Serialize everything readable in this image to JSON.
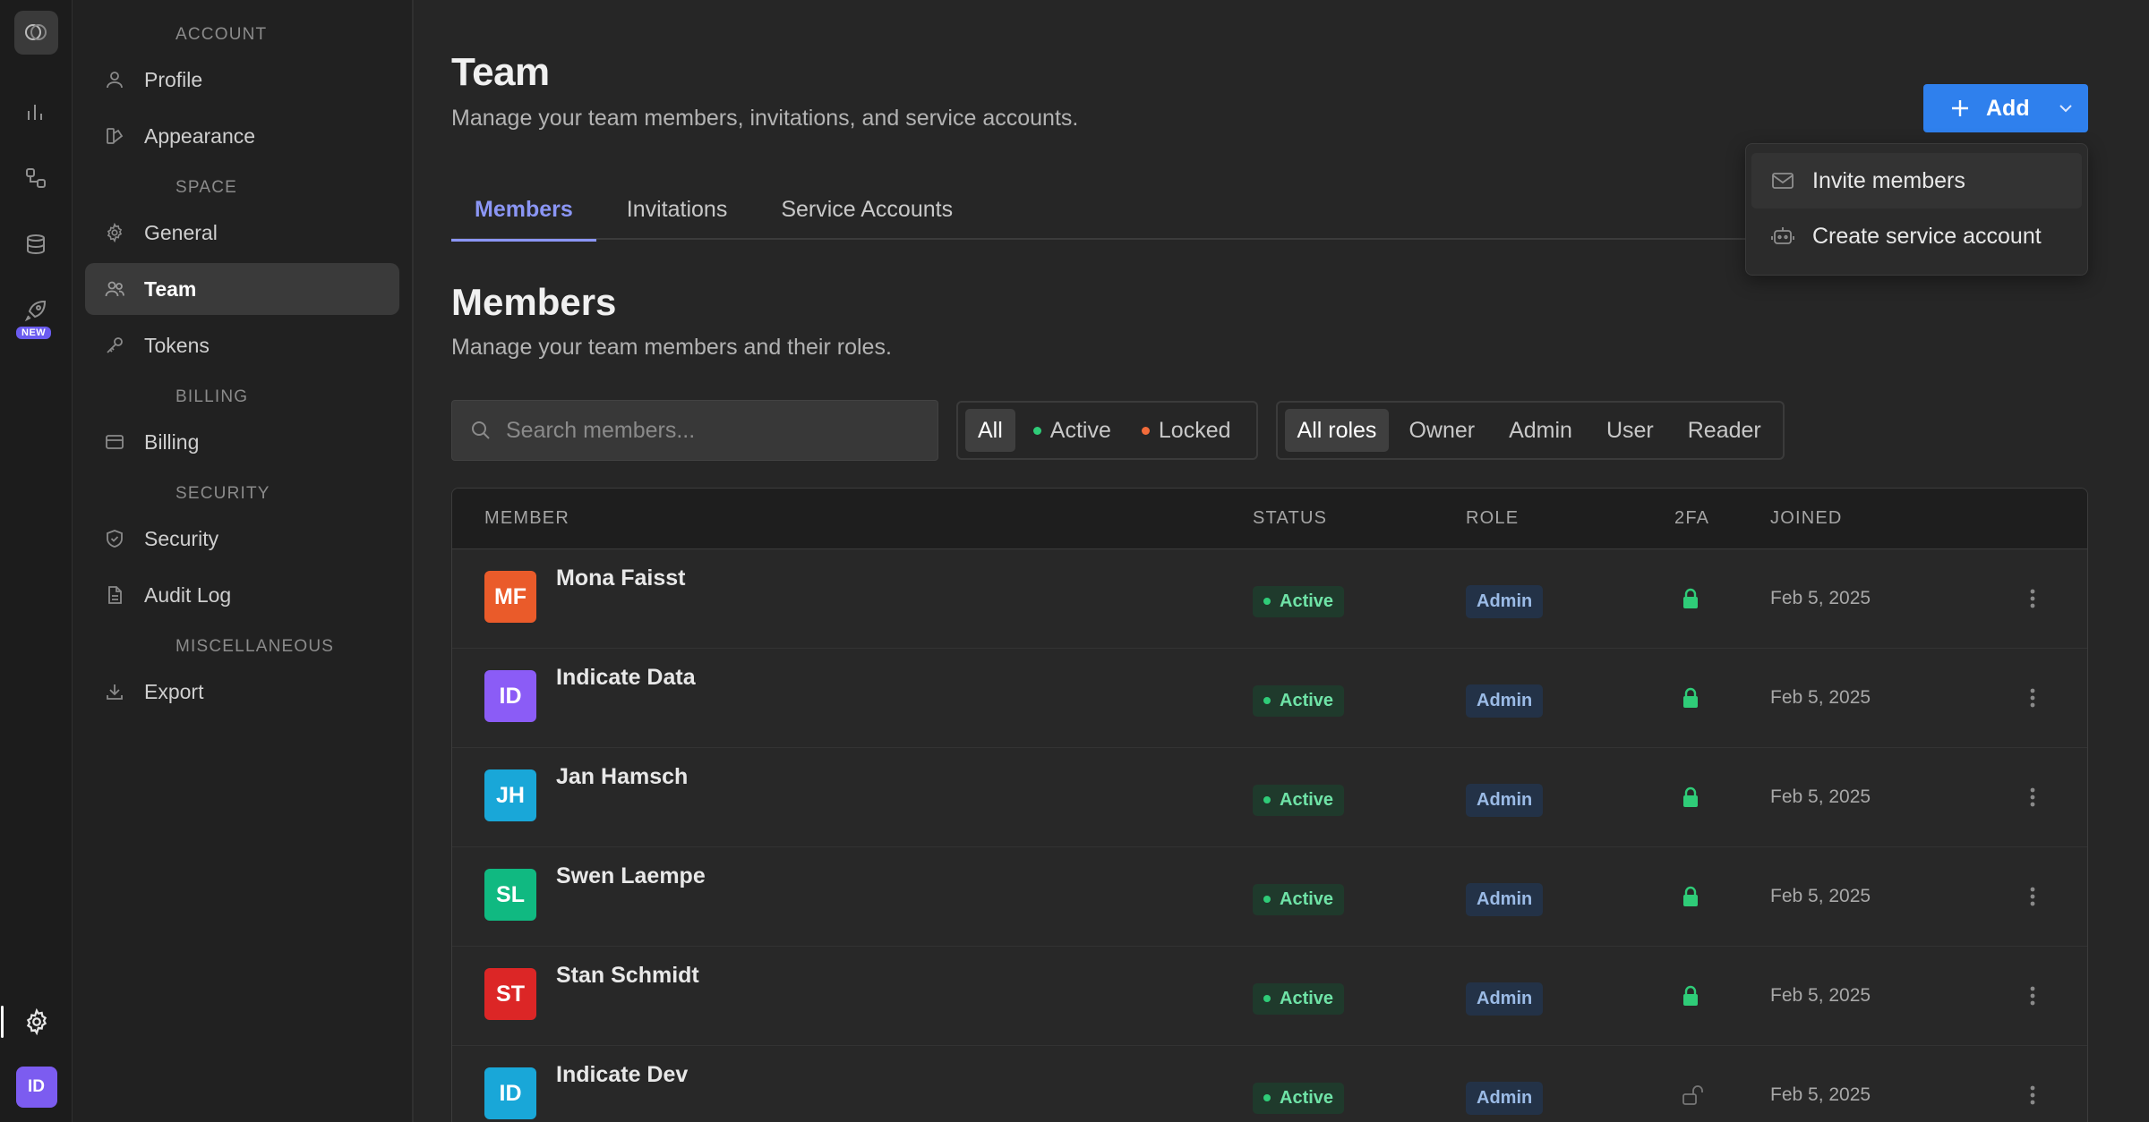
{
  "sidebar": {
    "groups": [
      {
        "title": "ACCOUNT",
        "items": [
          {
            "label": "Profile"
          },
          {
            "label": "Appearance"
          }
        ]
      },
      {
        "title": "SPACE",
        "items": [
          {
            "label": "General"
          },
          {
            "label": "Team"
          },
          {
            "label": "Tokens"
          }
        ]
      },
      {
        "title": "BILLING",
        "items": [
          {
            "label": "Billing"
          }
        ]
      },
      {
        "title": "SECURITY",
        "items": [
          {
            "label": "Security"
          },
          {
            "label": "Audit Log"
          }
        ]
      },
      {
        "title": "MISCELLANEOUS",
        "items": [
          {
            "label": "Export"
          }
        ]
      }
    ],
    "active_item": "Team"
  },
  "rail": {
    "new_badge": "NEW",
    "user_initials": "ID",
    "icons": [
      "app-logo-icon",
      "bar-chart-icon",
      "workflow-icon",
      "database-icon",
      "rocket-icon",
      "gear-icon"
    ]
  },
  "header": {
    "title": "Team",
    "subtitle": "Manage your team members, invitations, and service accounts.",
    "add_label": "Add"
  },
  "add_menu": {
    "items": [
      {
        "label": "Invite members"
      },
      {
        "label": "Create service account"
      }
    ]
  },
  "tabs": [
    {
      "label": "Members"
    },
    {
      "label": "Invitations"
    },
    {
      "label": "Service Accounts"
    }
  ],
  "members_section": {
    "title": "Members",
    "subtitle": "Manage your team members and their roles.",
    "search_placeholder": "Search members...",
    "status_filters": [
      {
        "label": "All"
      },
      {
        "label": "Active"
      },
      {
        "label": "Locked"
      }
    ],
    "role_filters": [
      {
        "label": "All roles"
      },
      {
        "label": "Owner"
      },
      {
        "label": "Admin"
      },
      {
        "label": "User"
      },
      {
        "label": "Reader"
      }
    ]
  },
  "table": {
    "columns": [
      "MEMBER",
      "STATUS",
      "ROLE",
      "2FA",
      "JOINED"
    ],
    "rows": [
      {
        "initials": "MF",
        "name": "Mona Faisst",
        "status": "Active",
        "role": "Admin",
        "twofa": "enabled",
        "joined": "Feb 5, 2025",
        "color": "#ea5b2a"
      },
      {
        "initials": "ID",
        "name": "Indicate Data",
        "status": "Active",
        "role": "Admin",
        "twofa": "enabled",
        "joined": "Feb 5, 2025",
        "color": "#8b5cf6"
      },
      {
        "initials": "JH",
        "name": "Jan Hamsch",
        "status": "Active",
        "role": "Admin",
        "twofa": "enabled",
        "joined": "Feb 5, 2025",
        "color": "#19a7d8"
      },
      {
        "initials": "SL",
        "name": "Swen Laempe",
        "status": "Active",
        "role": "Admin",
        "twofa": "enabled",
        "joined": "Feb 5, 2025",
        "color": "#10b981"
      },
      {
        "initials": "ST",
        "name": "Stan Schmidt",
        "status": "Active",
        "role": "Admin",
        "twofa": "enabled",
        "joined": "Feb 5, 2025",
        "color": "#dc2626"
      },
      {
        "initials": "ID",
        "name": "Indicate Dev",
        "status": "Active",
        "role": "Admin",
        "twofa": "disabled",
        "joined": "Feb 5, 2025",
        "color": "#19a7d8"
      }
    ]
  },
  "colors": {
    "accent": "#2f80ed",
    "tab_active": "#8b96f5",
    "status_green": "#2fcc78",
    "locked_orange": "#f26b3a"
  }
}
